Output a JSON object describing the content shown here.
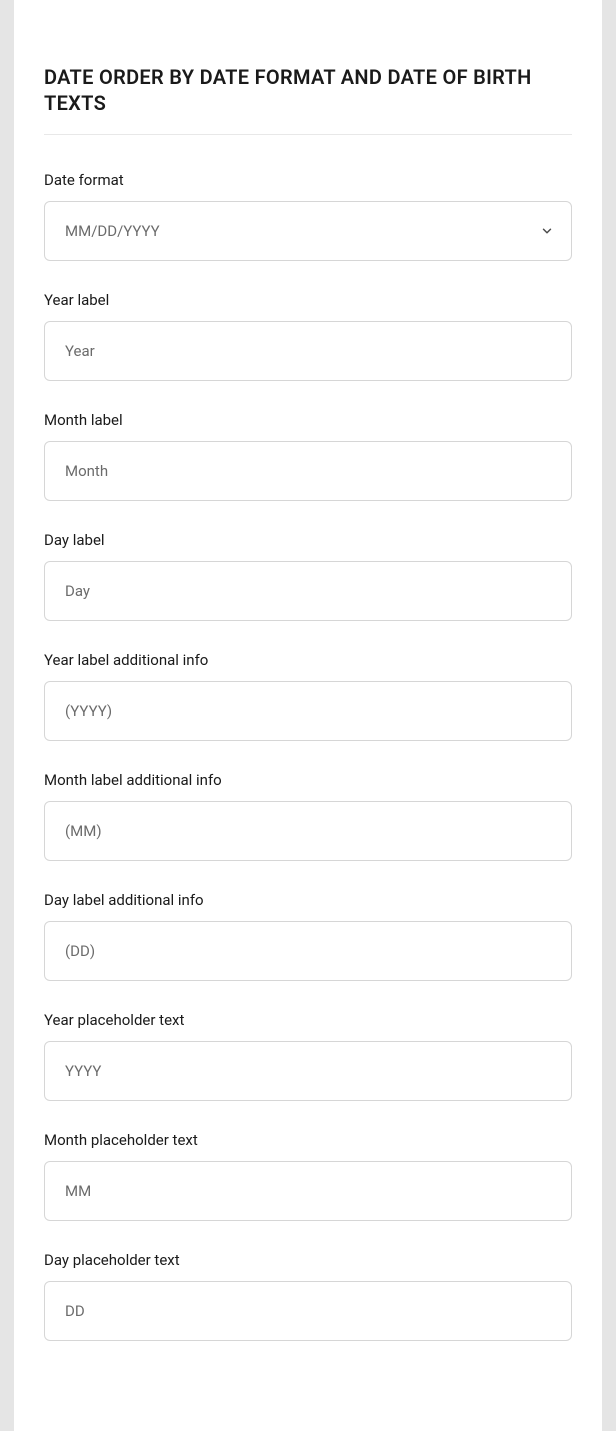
{
  "section": {
    "title": "DATE ORDER BY DATE FORMAT AND DATE OF BIRTH TEXTS"
  },
  "fields": {
    "date_format": {
      "label": "Date format",
      "value": "MM/DD/YYYY"
    },
    "year_label": {
      "label": "Year label",
      "value": "Year"
    },
    "month_label": {
      "label": "Month label",
      "value": "Month"
    },
    "day_label": {
      "label": "Day label",
      "value": "Day"
    },
    "year_label_info": {
      "label": "Year label additional info",
      "value": "(YYYY)"
    },
    "month_label_info": {
      "label": "Month label additional info",
      "value": "(MM)"
    },
    "day_label_info": {
      "label": "Day label additional info",
      "value": "(DD)"
    },
    "year_placeholder": {
      "label": "Year placeholder text",
      "value": "YYYY"
    },
    "month_placeholder": {
      "label": "Month placeholder text",
      "value": "MM"
    },
    "day_placeholder": {
      "label": "Day placeholder text",
      "value": "DD"
    }
  }
}
